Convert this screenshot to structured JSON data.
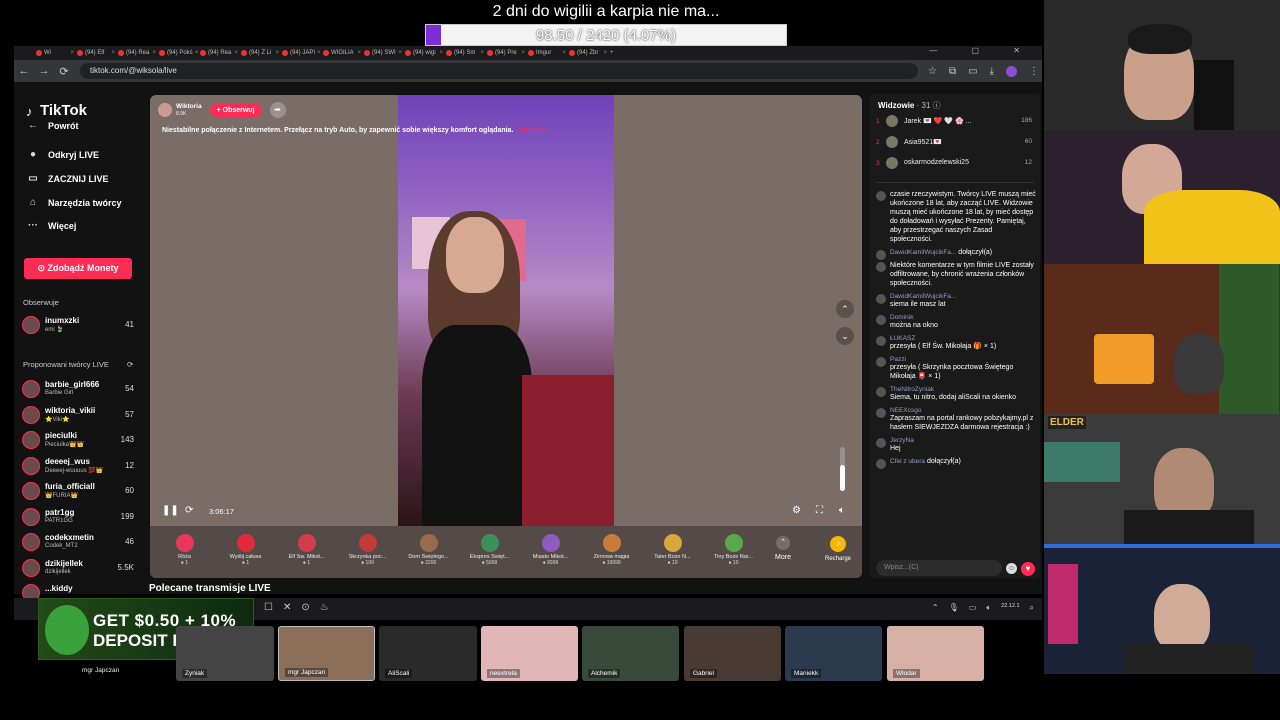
{
  "overlay": {
    "title": "2 dni do wigilii a karpia nie ma...",
    "progress_text": "98.50 / 2420 (4.07%)",
    "progress_fraction": 0.0407
  },
  "browser": {
    "url": "tiktok.com/@wiksola/live",
    "tabs": [
      "Wi",
      "(94) Elf",
      "(94) Rea",
      "(94) Pokś",
      "(94) Rea",
      "(94) Z Li",
      "(94) JAPI",
      "WIGILIA",
      "(94) SWI",
      "(94) wigi",
      "(94) Sm",
      "(94) Pre",
      "Imgur",
      "(94) Zbr"
    ],
    "tab_close": "×",
    "new_tab": "+",
    "window_controls": "— ▢ ✕",
    "nav": {
      "back": "←",
      "forward": "→",
      "reload": "⟳"
    }
  },
  "sidebar": {
    "logo": "TikTok",
    "items": [
      {
        "label": "Powrót",
        "icon": "back-arrow-icon",
        "glyph": "←"
      },
      {
        "label": "Odkryj LIVE",
        "icon": "live-discover-icon",
        "glyph": "●"
      },
      {
        "label": "ZACZNIJ LIVE",
        "icon": "camera-icon",
        "glyph": "▭"
      },
      {
        "label": "Narzędzia twórcy",
        "icon": "creator-tools-icon",
        "glyph": "⌂"
      },
      {
        "label": "Więcej",
        "icon": "more-dots-icon",
        "glyph": "···"
      }
    ],
    "coins_button": "Zdobądź Monety",
    "following_heading": "Obserwuje",
    "following": [
      {
        "name": "inumxzki",
        "sub": "emi 🍃",
        "count": "41"
      }
    ],
    "suggested_heading": "Proponowani twórcy LIVE",
    "suggested": [
      {
        "name": "barbie_girl666",
        "sub": "Barbie Girl",
        "count": "54"
      },
      {
        "name": "wiktoria_vikii",
        "sub": "⭐Viki⭐",
        "count": "57"
      },
      {
        "name": "pieciulki",
        "sub": "Pieciulka👑👑",
        "count": "143"
      },
      {
        "name": "deeeej_wus",
        "sub": "Deeeej-wuuuus 💯👑",
        "count": "12"
      },
      {
        "name": "furia_officiall",
        "sub": "👑FURIA👑",
        "count": "60"
      },
      {
        "name": "patr1gg",
        "sub": "PATR1GG",
        "count": "199"
      },
      {
        "name": "codekxmetin",
        "sub": "Codek_MT2",
        "count": "46"
      },
      {
        "name": "dzikijellek",
        "sub": "dzikijellek",
        "count": "5.5K"
      },
      {
        "name": "...kiddy",
        "sub": "",
        "count": ""
      }
    ]
  },
  "player": {
    "streamer": "Wiktoria",
    "likes": "8.9K",
    "follow_label": "+ Obserwuj",
    "share_glyph": "➦",
    "warning": "Niestabilne połączenie z Internetem. Przełącz na tryb Auto, by zapewnić sobie większy komfort oglądania.",
    "warning_link": "przełącz",
    "time": "3:06:17",
    "volume_fraction": 0.6,
    "gifts": [
      {
        "name": "Róża",
        "price": "1",
        "color": "#e8375a"
      },
      {
        "name": "Wyślij całusa",
        "price": "1",
        "color": "#e02b3e"
      },
      {
        "name": "Elf Św. Mikoł...",
        "price": "1",
        "color": "#d33c4a"
      },
      {
        "name": "Skrzynka poc...",
        "price": "199",
        "color": "#c23a3a"
      },
      {
        "name": "Dom Świętego...",
        "price": "2200",
        "color": "#9a6a4c"
      },
      {
        "name": "Ekspres Święt...",
        "price": "5999",
        "color": "#3f8f5a"
      },
      {
        "name": "Miasto Mikoł...",
        "price": "9999",
        "color": "#8e5bbf"
      },
      {
        "name": "Zimowa magia",
        "price": "19999",
        "color": "#c97a3a"
      },
      {
        "name": "Tater Boże N...",
        "price": "10",
        "color": "#d9a63a"
      },
      {
        "name": "Tiny Boże Nar...",
        "price": "10",
        "color": "#5aa84a"
      }
    ],
    "more_label": "More",
    "recharge_label": "Recharge"
  },
  "recommended_label": "Polecane transmisje LIVE",
  "chat": {
    "viewers_label": "Widzowie",
    "viewers_count": "· 31",
    "top_viewers": [
      {
        "rank": "1",
        "name": "Jarek 💌 ❤️ 🤍 🌸 ...",
        "score": "186"
      },
      {
        "rank": "2",
        "name": "Asia9521💌",
        "score": "60"
      },
      {
        "rank": "3",
        "name": "oskarmodzelewski25",
        "score": "12"
      }
    ],
    "messages": [
      {
        "user": "",
        "text": "czasie rzeczywistym. Twórcy LIVE muszą mieć ukończone 18 lat, aby zacząć LIVE. Widzowie muszą mieć ukończone 18 lat, by mieć dostęp do doładowań i wysyłać Prezenty. Pamiętaj, aby przestrzegać naszych Zasad społeczności."
      },
      {
        "user": "DawidKamilWujcikFa...",
        "text": "dołączył(a)",
        "join": true
      },
      {
        "user": "",
        "text": "Niektóre komentarze w tym filmie LIVE zostały odfiltrowane, by chronić wrażenia członków społeczności."
      },
      {
        "user": "DawidKamilWujcikFa...",
        "text": "siema ile masz lat"
      },
      {
        "user": "Dominik",
        "text": "można na okno"
      },
      {
        "user": "ŁUKASZ",
        "text": "przesyła ( Elf Św. Mikołaja 🎁 × 1)"
      },
      {
        "user": "Pazzi",
        "text": "przesyła ( Skrzynka pocztowa Świętego Mikołaja 📮 × 1)"
      },
      {
        "user": "TheNitroZyniak",
        "text": "Siema, tu nitro, dodaj aliScali na okienko"
      },
      {
        "user": "NEEXcsgo",
        "text": "Zapraszam na portal rankowy pobzykajmy.pl z hasłem SIEWJEZDZA darmowa rejestracja :)"
      },
      {
        "user": "JerzyNa",
        "text": "Hej"
      },
      {
        "user": "Cfel z ubera",
        "text": "dołączył(a)",
        "join": true
      }
    ],
    "input_placeholder": "Wpisz...(C)"
  },
  "taskbar": {
    "clock": "22.12.1",
    "icons": [
      "☐",
      "✕",
      "⊙",
      "♨"
    ]
  },
  "ad": {
    "line1": "GET $0.50 + 10%",
    "line2": "DEPOSIT BONUS"
  },
  "participants": [
    {
      "label": "mgr Japczan"
    },
    {
      "label": "Zyniak"
    },
    {
      "label": "mgr Japczan"
    },
    {
      "label": "AliScali"
    },
    {
      "label": "neextrela"
    },
    {
      "label": "Alchemik"
    },
    {
      "label": "Gabriel"
    },
    {
      "label": "Maniekk"
    },
    {
      "label": "Włodar"
    }
  ],
  "webcam_overlay_tag": "ELDER"
}
